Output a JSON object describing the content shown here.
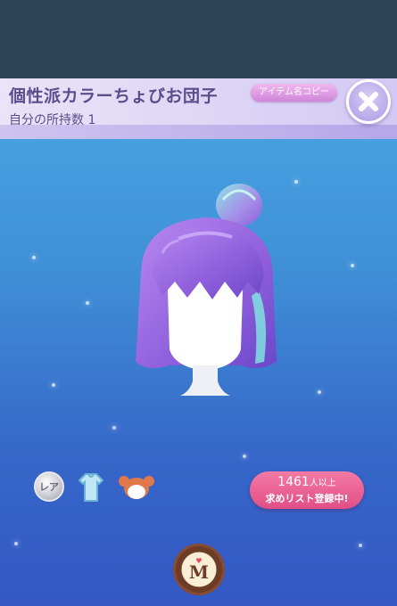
{
  "header": {
    "title": "個性派カラーちょびお団子",
    "owned_label": "自分の所持数 1",
    "copy_button": "アイテム名コピー",
    "close_icon": "close-icon"
  },
  "badges": {
    "rarity_label": "レア",
    "category_icon": "outfit-icon",
    "type_icon": "hair-icon"
  },
  "request": {
    "count": "1461",
    "count_suffix": "人以上",
    "label": "求めリスト登録中!"
  },
  "medal": {
    "letter": "M",
    "icon": "heart-icon"
  },
  "colors": {
    "hair_main": "#9a6ee0",
    "hair_highlight": "#7fe3e0",
    "request_pink": "#e8588f",
    "header_text": "#5a4d8c"
  }
}
